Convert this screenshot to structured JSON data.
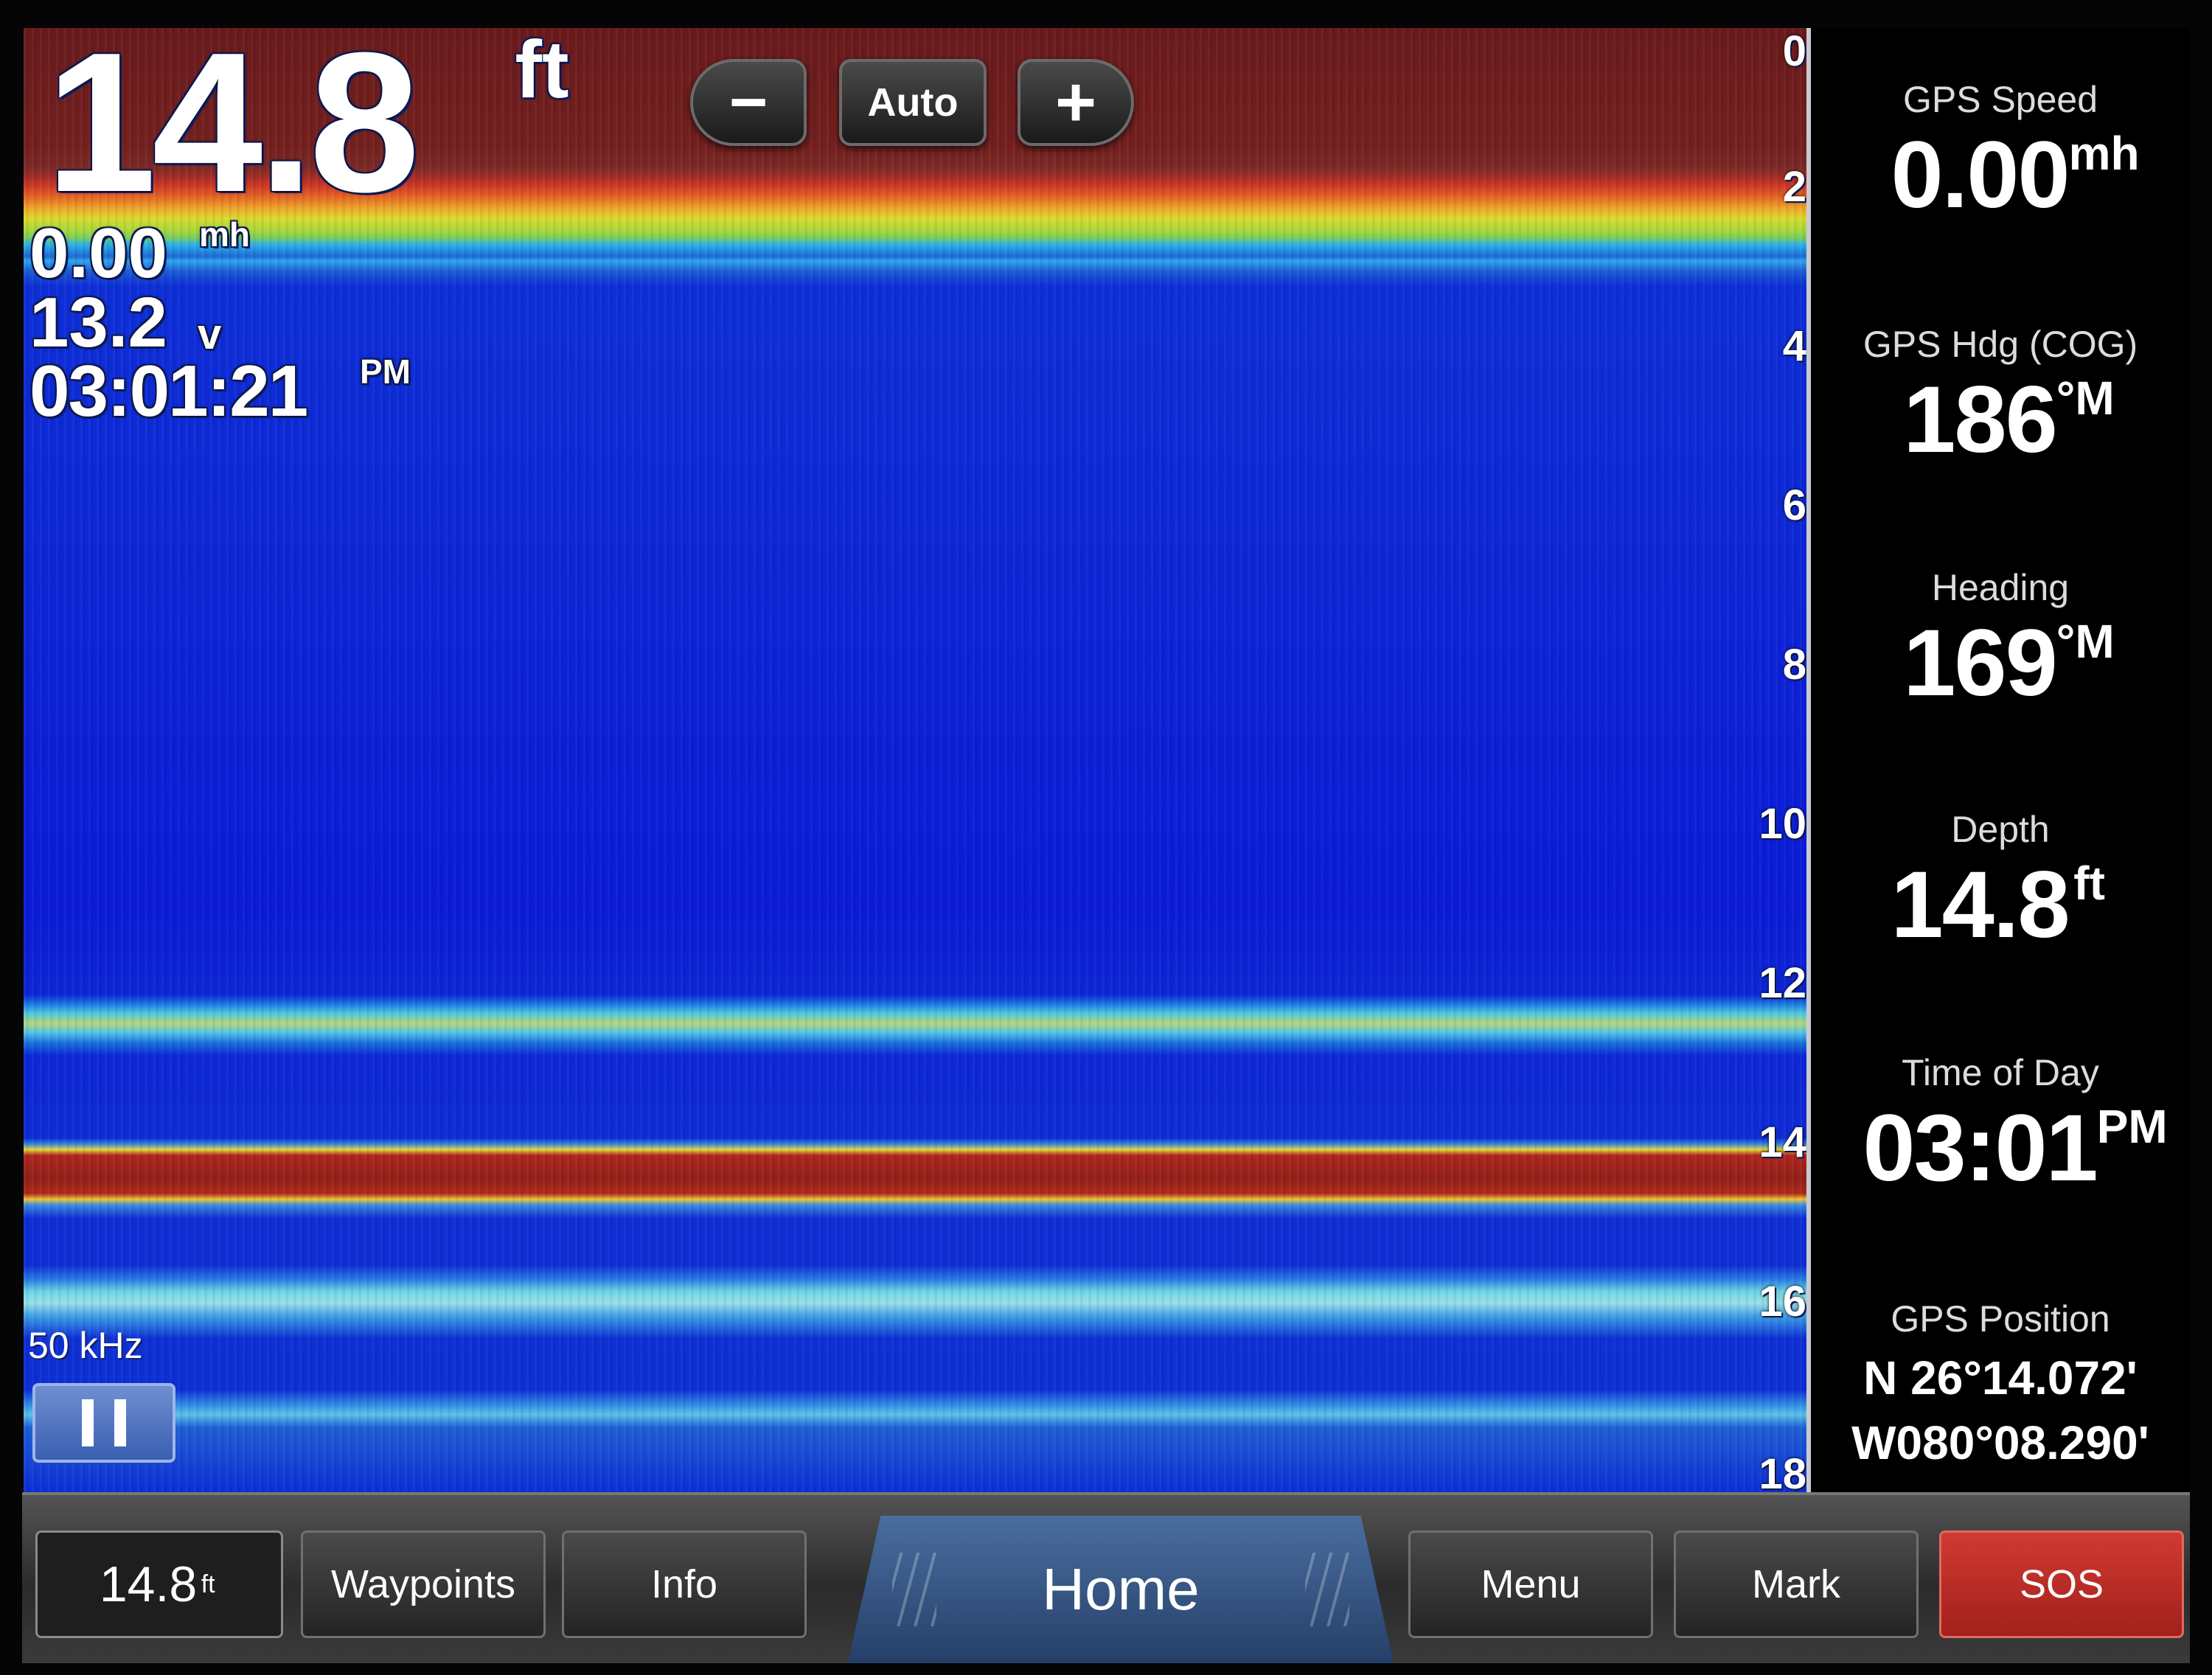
{
  "overlay": {
    "depth_value": "14.8",
    "depth_unit": "ft",
    "speed_value": "0.00",
    "speed_unit": "mh",
    "voltage_value": "13.2",
    "voltage_unit": "v",
    "time_value": "03:01:21",
    "time_unit": "PM"
  },
  "zoom": {
    "minus_label": "−",
    "auto_label": "Auto",
    "plus_label": "+"
  },
  "depth_scale": [
    "0",
    "2",
    "4",
    "6",
    "8",
    "10",
    "12",
    "14",
    "16",
    "18"
  ],
  "frequency": "50 kHz",
  "data_fields": {
    "gps_speed": {
      "label": "GPS Speed",
      "value": "0.00",
      "unit": "mh"
    },
    "gps_heading": {
      "label": "GPS Hdg (COG)",
      "value": "186",
      "unit": "°M"
    },
    "heading": {
      "label": "Heading",
      "value": "169",
      "unit": "°M"
    },
    "depth": {
      "label": "Depth",
      "value": "14.8",
      "unit": "ft"
    },
    "time_of_day": {
      "label": "Time of Day",
      "value": "03:01",
      "unit": "PM"
    },
    "gps_position": {
      "label": "GPS Position",
      "lat": "N  26°14.072'",
      "lon": "W080°08.290'"
    }
  },
  "bottom_bar": {
    "depth_readout": "14.8",
    "depth_unit": "ft",
    "waypoints": "Waypoints",
    "info": "Info",
    "home": "Home",
    "menu": "Menu",
    "mark": "Mark",
    "sos": "SOS"
  }
}
